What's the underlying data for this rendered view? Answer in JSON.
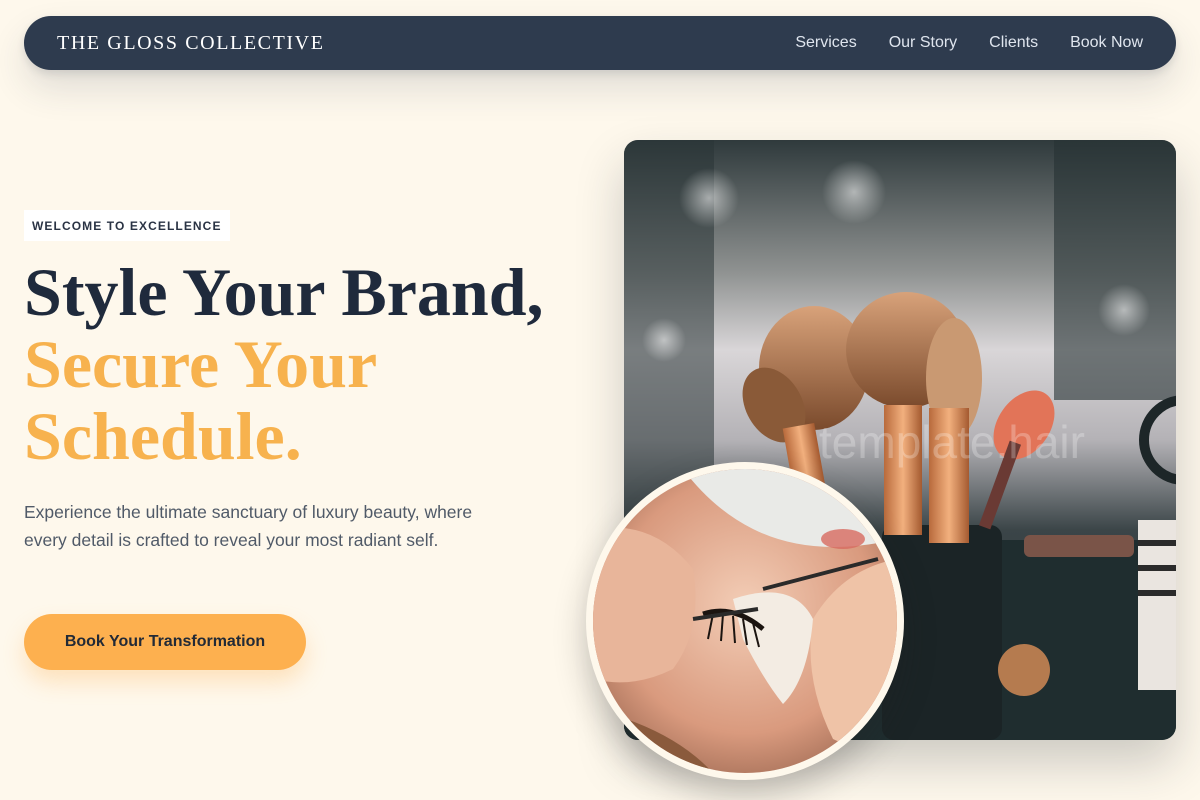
{
  "nav": {
    "brand": "THE GLOSS COLLECTIVE",
    "links": [
      {
        "label": "Services"
      },
      {
        "label": "Our Story"
      },
      {
        "label": "Clients"
      },
      {
        "label": "Book Now"
      }
    ]
  },
  "hero": {
    "eyebrow": "WELCOME TO EXCELLENCE",
    "headline_line1": "Style Your Brand,",
    "headline_line2": "Secure Your",
    "headline_line3": "Schedule.",
    "lede": "Experience the ultimate sanctuary of luxury beauty, where every detail is crafted to reveal your most radiant self.",
    "cta_label": "Book Your Transformation",
    "main_image_watermark": "template.hair"
  },
  "colors": {
    "background": "#fef8ec",
    "nav_bg": "#2e3b4e",
    "headline_dark": "#1f2a3c",
    "accent": "#f7b24e",
    "cta": "#fdb04f"
  }
}
